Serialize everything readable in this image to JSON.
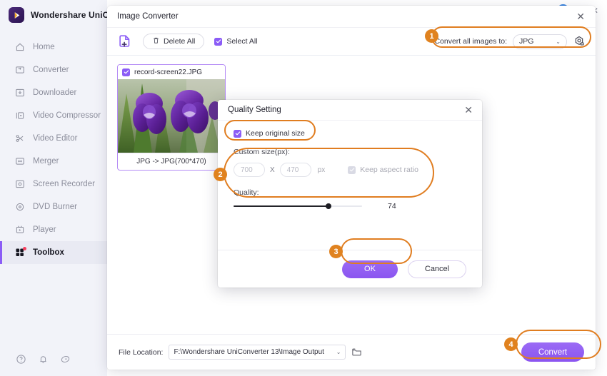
{
  "app": {
    "brand": "Wondershare UniConverter",
    "logo_icon": "play-logo-icon",
    "sidebar": {
      "items": [
        {
          "label": "Home",
          "icon": "home-icon"
        },
        {
          "label": "Converter",
          "icon": "converter-icon"
        },
        {
          "label": "Downloader",
          "icon": "download-icon"
        },
        {
          "label": "Video Compressor",
          "icon": "compressor-icon"
        },
        {
          "label": "Video Editor",
          "icon": "scissors-icon"
        },
        {
          "label": "Merger",
          "icon": "merger-icon"
        },
        {
          "label": "Screen Recorder",
          "icon": "record-icon"
        },
        {
          "label": "DVD Burner",
          "icon": "disc-icon"
        },
        {
          "label": "Player",
          "icon": "player-icon"
        },
        {
          "label": "Toolbox",
          "icon": "toolbox-icon",
          "active": true,
          "has_dot": true
        }
      ],
      "footer_icons": [
        "help-icon",
        "bell-icon",
        "feedback-icon"
      ]
    },
    "window": {
      "close_glyph": "✕"
    }
  },
  "converter": {
    "title": "Image Converter",
    "close_glyph": "✕",
    "toolbar": {
      "add_file_icon": "add-file-icon",
      "delete_all_label": "Delete All",
      "delete_icon": "trash-icon",
      "select_all_label": "Select All",
      "convert_to_label": "Convert all images to:",
      "format_value": "JPG",
      "caret_glyph": "⌄",
      "gear_icon": "format-settings-icon"
    },
    "file_card": {
      "name": "record-screen22.JPG",
      "conversion": "JPG -> JPG(700*470)",
      "thumb_alt": "purple-iris-flowers"
    },
    "bottom": {
      "file_location_label": "File Location:",
      "file_location_value": "F:\\Wondershare UniConverter 13\\Image Output",
      "caret_glyph": "⌄",
      "folder_icon": "folder-icon",
      "convert_label": "Convert"
    }
  },
  "quality_dialog": {
    "title": "Quality Setting",
    "close_glyph": "✕",
    "keep_original_label": "Keep original size",
    "keep_original_checked": true,
    "custom_size_label": "Custom size(px):",
    "width_value": "700",
    "height_value": "470",
    "x_sep": "X",
    "unit": "px",
    "keep_aspect_label": "Keep aspect ratio",
    "quality_label": "Quality:",
    "quality_value": "74",
    "ok_label": "OK",
    "cancel_label": "Cancel"
  },
  "annotations": {
    "accent_color": "#e0821f",
    "steps": [
      {
        "number": "1",
        "target": "format-dropdown-area"
      },
      {
        "number": "2",
        "target": "custom-size-area"
      },
      {
        "number": "3",
        "target": "ok-button"
      },
      {
        "number": "4",
        "target": "convert-button"
      }
    ]
  }
}
